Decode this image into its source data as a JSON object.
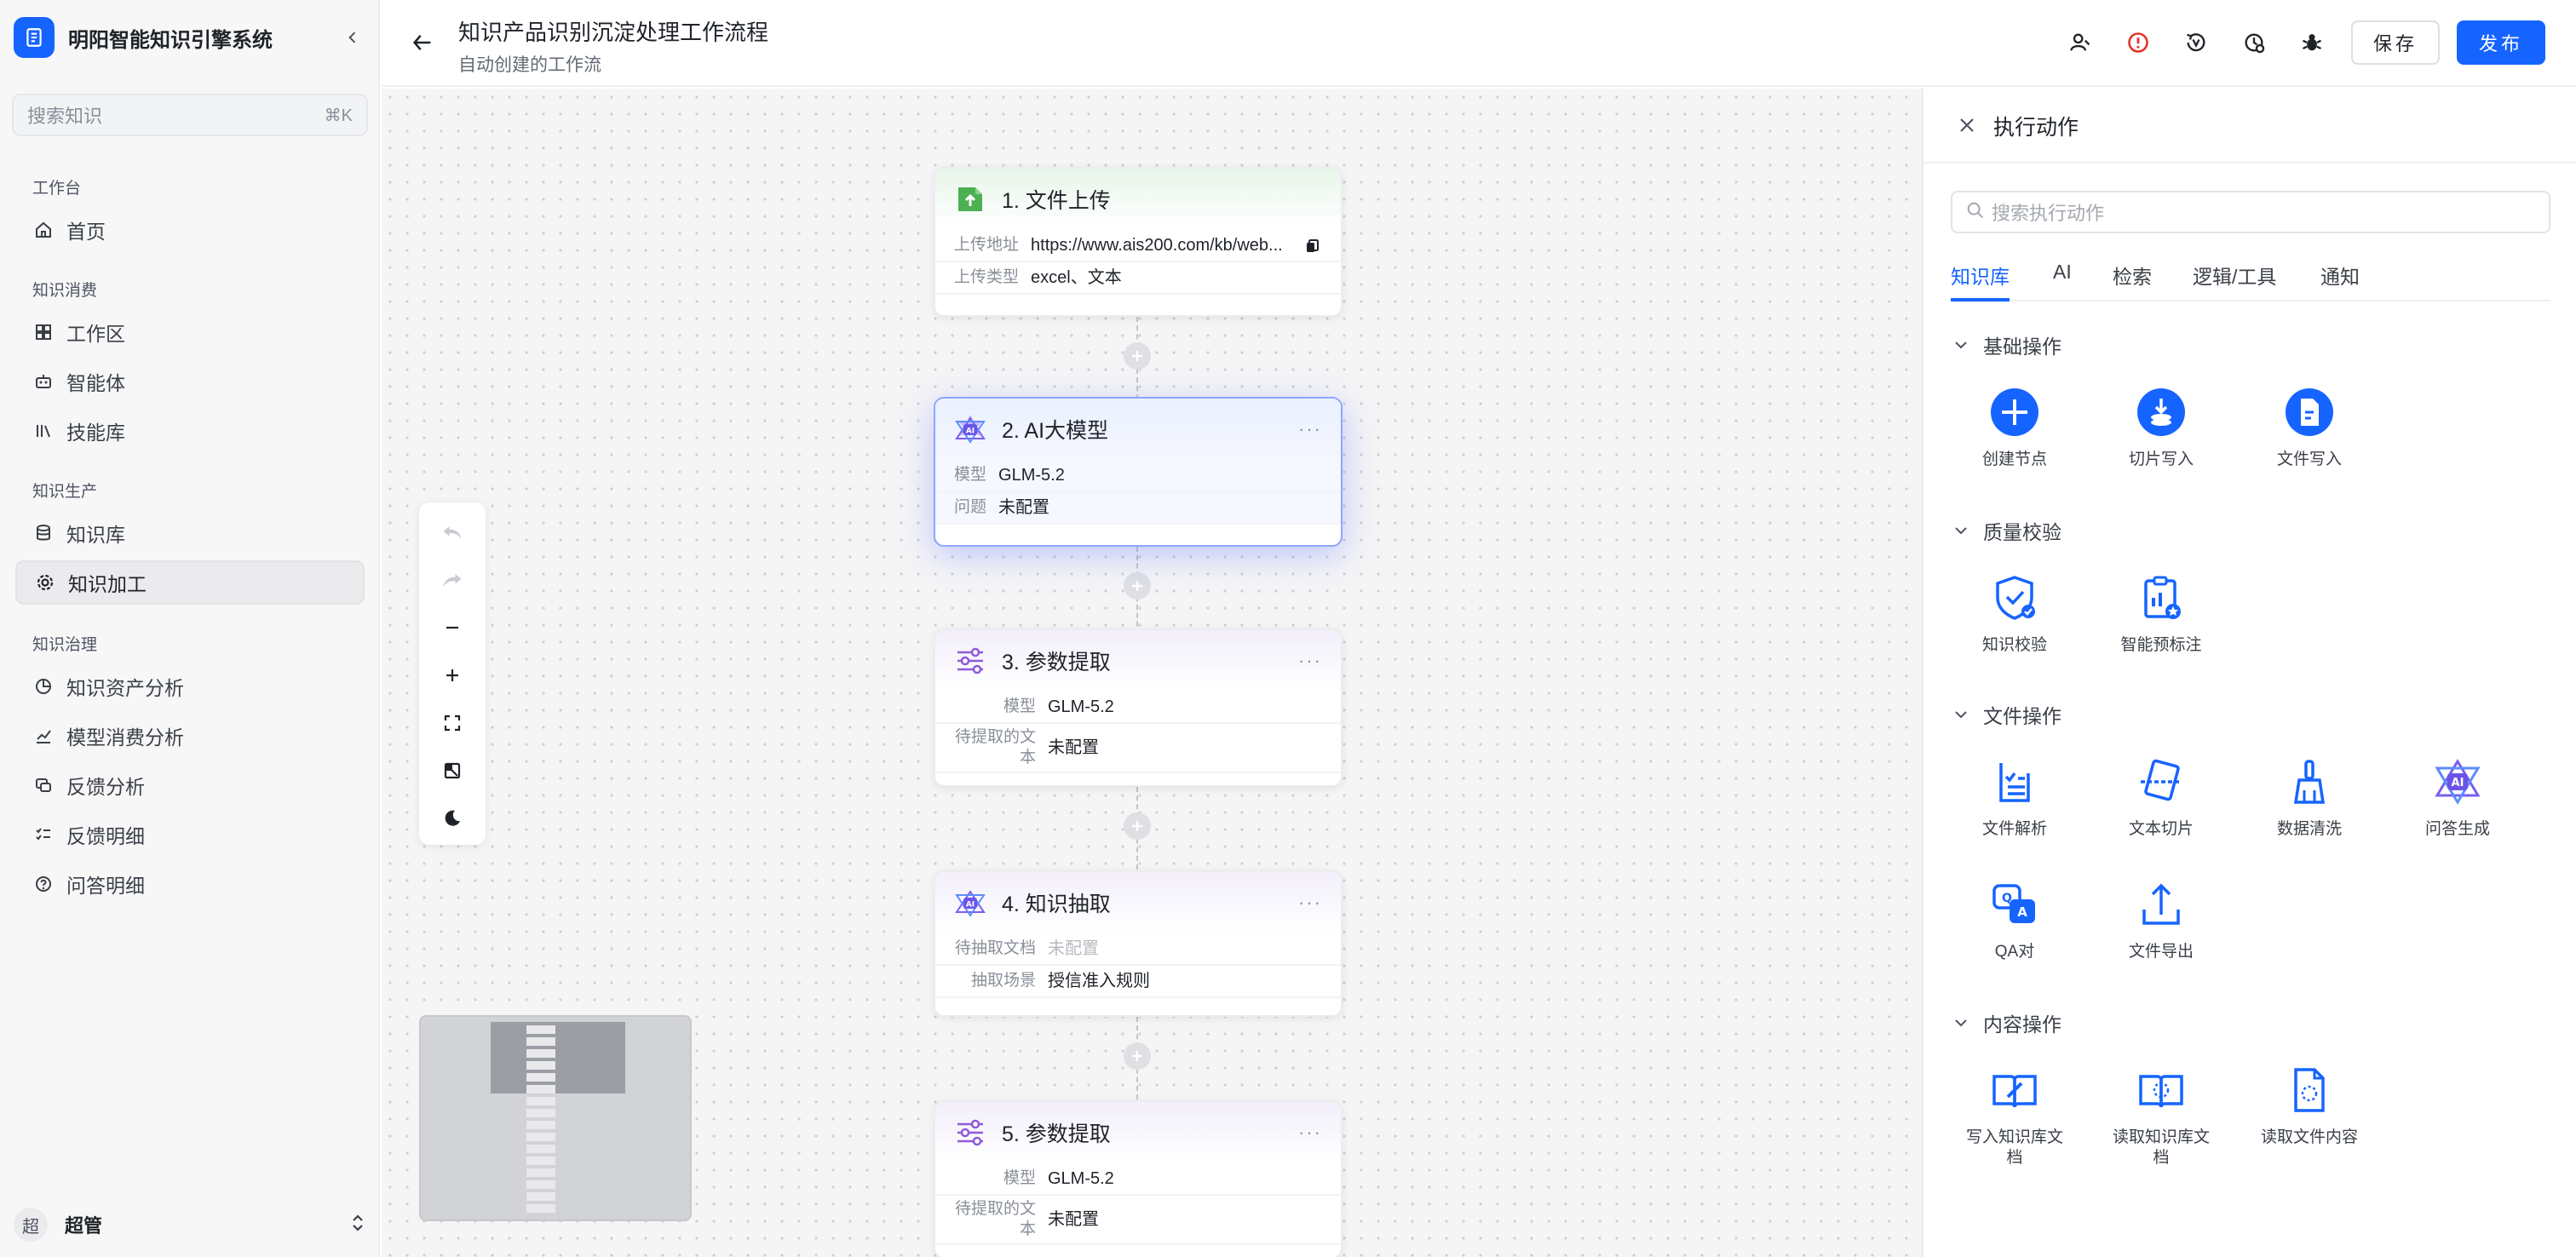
{
  "app": {
    "name": "明阳智能知识引擎系统"
  },
  "sidebar": {
    "search_placeholder": "搜索知识",
    "search_shortcut": "⌘K",
    "sections": [
      {
        "title": "工作台",
        "items": [
          {
            "label": "首页",
            "icon": "home-icon"
          }
        ]
      },
      {
        "title": "知识消费",
        "items": [
          {
            "label": "工作区",
            "icon": "grid-icon"
          },
          {
            "label": "智能体",
            "icon": "robot-icon"
          },
          {
            "label": "技能库",
            "icon": "library-icon"
          }
        ]
      },
      {
        "title": "知识生产",
        "items": [
          {
            "label": "知识库",
            "icon": "database-icon"
          },
          {
            "label": "知识加工",
            "icon": "gear-icon",
            "active": true
          }
        ]
      },
      {
        "title": "知识治理",
        "items": [
          {
            "label": "知识资产分析",
            "icon": "pie-chart-icon"
          },
          {
            "label": "模型消费分析",
            "icon": "bar-chart-icon"
          },
          {
            "label": "反馈分析",
            "icon": "feedback-icon"
          },
          {
            "label": "反馈明细",
            "icon": "checklist-icon"
          },
          {
            "label": "问答明细",
            "icon": "question-icon"
          }
        ]
      }
    ],
    "user": {
      "avatar_text": "超",
      "name": "超管"
    }
  },
  "header": {
    "title": "知识产品识别沉淀处理工作流程",
    "subtitle": "自动创建的工作流",
    "save_label": "保存",
    "publish_label": "发布"
  },
  "nodes": [
    {
      "title": "1. 文件上传",
      "icon": "upload-icon",
      "rows": [
        {
          "k": "上传地址",
          "v": "https://www.ais200.com/kb/web..."
        },
        {
          "k": "上传类型",
          "v": "excel、文本"
        }
      ]
    },
    {
      "title": "2. AI大模型",
      "icon": "ai-icon",
      "more": "···",
      "rows": [
        {
          "k": "模型",
          "v": "GLM-5.2"
        },
        {
          "k": "问题",
          "v": "未配置"
        }
      ]
    },
    {
      "title": "3. 参数提取",
      "icon": "sliders-icon",
      "more": "···",
      "rows": [
        {
          "k": "模型",
          "v": "GLM-5.2"
        },
        {
          "k": "待提取的文",
          "k2": "本",
          "v": "未配置"
        }
      ]
    },
    {
      "title": "4. 知识抽取",
      "icon": "ai-icon",
      "more": "···",
      "rows": [
        {
          "k": "待抽取文档",
          "v": "未配置"
        },
        {
          "k": "抽取场景",
          "v": "授信准入规则"
        }
      ]
    },
    {
      "title": "5. 参数提取",
      "icon": "sliders-icon",
      "more": "···",
      "rows": [
        {
          "k": "模型",
          "v": "GLM-5.2"
        },
        {
          "k": "待提取的文",
          "k2": "本",
          "v": "未配置"
        }
      ]
    }
  ],
  "panel": {
    "title": "执行动作",
    "search_placeholder": "搜索执行动作",
    "tabs": [
      "知识库",
      "AI",
      "检索",
      "逻辑/工具",
      "通知"
    ],
    "groups": [
      {
        "title": "基础操作",
        "actions": [
          "创建节点",
          "切片写入",
          "文件写入"
        ]
      },
      {
        "title": "质量校验",
        "actions": [
          "知识校验",
          "智能预标注"
        ]
      },
      {
        "title": "文件操作",
        "actions": [
          "文件解析",
          "文本切片",
          "数据清洗",
          "问答生成",
          "QA对",
          "文件导出"
        ]
      },
      {
        "title": "内容操作",
        "actions": [
          "写入知识库文",
          "档",
          "读取知识库文",
          "档",
          "读取文件内容"
        ]
      }
    ],
    "action_labels": {
      "create_node": "创建节点",
      "slice_write": "切片写入",
      "file_write": "文件写入",
      "knowledge_check": "知识校验",
      "smart_annotate": "智能预标注",
      "file_parse": "文件解析",
      "text_slice": "文本切片",
      "data_clean": "数据清洗",
      "qa_gen": "问答生成",
      "qa_pair": "QA对",
      "file_export": "文件导出",
      "write_kb_doc_1": "写入知识库文",
      "write_kb_doc_2": "档",
      "read_kb_doc_1": "读取知识库文",
      "read_kb_doc_2": "档",
      "read_file": "读取文件内容"
    }
  },
  "colors": {
    "accent": "#1664ff",
    "upload_green": "#4caf50",
    "ai_purple": "#7b5cf0"
  }
}
